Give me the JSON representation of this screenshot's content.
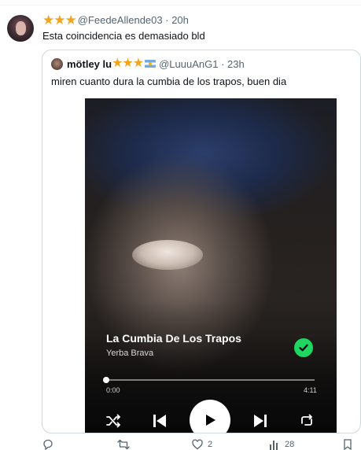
{
  "post": {
    "stars": "★★★",
    "handle": "@FeedeAllende03",
    "time": "20h",
    "text": "Esta coincidencia es demasiado bld"
  },
  "quoted": {
    "name": "mötley lu",
    "stars": "★★★",
    "handle": "@LuuuAnG1",
    "time": "23h",
    "text": "miren cuanto dura la cumbia de los trapos, buen dia"
  },
  "player": {
    "song_title": "La Cumbia De Los Trapos",
    "artist": "Yerba Brava",
    "time_elapsed": "0:00",
    "time_total": "4:11",
    "progress": 0.0,
    "accent_color": "#1ed760"
  },
  "actions": {
    "reply_count": "",
    "repost_count": "",
    "like_count": "2",
    "view_count": "28"
  },
  "icons": [
    "shuffle-icon",
    "previous-icon",
    "play-icon",
    "next-icon",
    "repeat-icon",
    "check-icon",
    "reply-icon",
    "repost-icon",
    "like-icon",
    "views-icon",
    "bookmark-icon"
  ]
}
